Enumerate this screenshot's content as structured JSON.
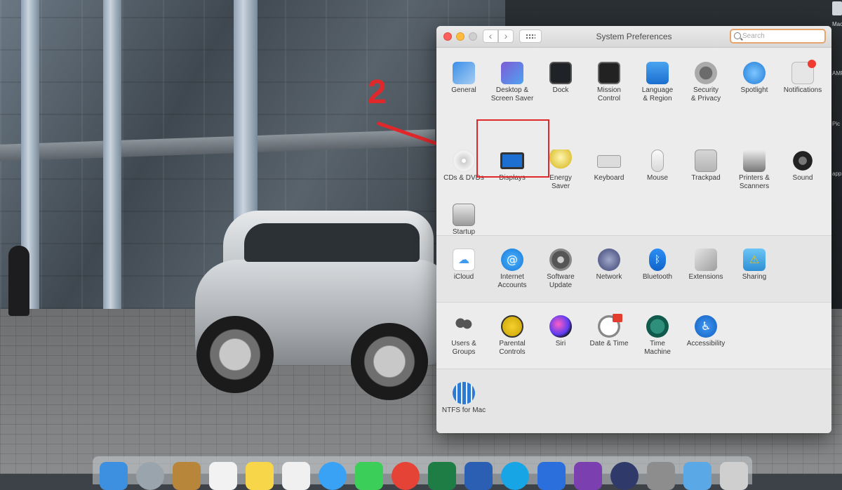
{
  "window": {
    "title": "System Preferences",
    "search_placeholder": "Search"
  },
  "sections": {
    "personal": [
      {
        "label": "General",
        "icon": "general-icon"
      },
      {
        "label": "Desktop &\nScreen Saver",
        "icon": "desktop-screensaver-icon"
      },
      {
        "label": "Dock",
        "icon": "dock-icon"
      },
      {
        "label": "Mission\nControl",
        "icon": "mission-control-icon"
      },
      {
        "label": "Language\n& Region",
        "icon": "language-region-icon"
      },
      {
        "label": "Security\n& Privacy",
        "icon": "security-privacy-icon"
      },
      {
        "label": "Spotlight",
        "icon": "spotlight-icon"
      },
      {
        "label": "Notifications",
        "icon": "notifications-icon"
      }
    ],
    "hardware": [
      {
        "label": "CDs & DVDs",
        "icon": "cds-dvds-icon"
      },
      {
        "label": "Displays",
        "icon": "displays-icon"
      },
      {
        "label": "Energy\nSaver",
        "icon": "energy-saver-icon"
      },
      {
        "label": "Keyboard",
        "icon": "keyboard-icon"
      },
      {
        "label": "Mouse",
        "icon": "mouse-icon"
      },
      {
        "label": "Trackpad",
        "icon": "trackpad-icon"
      },
      {
        "label": "Printers &\nScanners",
        "icon": "printers-scanners-icon"
      },
      {
        "label": "Sound",
        "icon": "sound-icon"
      },
      {
        "label": "Startup\nDisk",
        "icon": "startup-disk-icon"
      }
    ],
    "internet": [
      {
        "label": "iCloud",
        "icon": "icloud-icon"
      },
      {
        "label": "Internet\nAccounts",
        "icon": "internet-accounts-icon"
      },
      {
        "label": "Software\nUpdate",
        "icon": "software-update-icon"
      },
      {
        "label": "Network",
        "icon": "network-icon"
      },
      {
        "label": "Bluetooth",
        "icon": "bluetooth-icon"
      },
      {
        "label": "Extensions",
        "icon": "extensions-icon"
      },
      {
        "label": "Sharing",
        "icon": "sharing-icon"
      }
    ],
    "system": [
      {
        "label": "Users &\nGroups",
        "icon": "users-groups-icon"
      },
      {
        "label": "Parental\nControls",
        "icon": "parental-controls-icon"
      },
      {
        "label": "Siri",
        "icon": "siri-icon"
      },
      {
        "label": "Date & Time",
        "icon": "date-time-icon"
      },
      {
        "label": "Time\nMachine",
        "icon": "time-machine-icon"
      },
      {
        "label": "Accessibility",
        "icon": "accessibility-icon"
      }
    ],
    "other": [
      {
        "label": "NTFS for Mac",
        "icon": "ntfs-icon"
      }
    ]
  },
  "annotation": {
    "step": "2",
    "color": "#e0282b",
    "highlighted_item": "Displays"
  },
  "desktop": {
    "edge_labels": [
      "Macintosh HD",
      "AMP",
      "Pic",
      "app"
    ]
  },
  "colors": {
    "search_focus": "#e8a56b",
    "close": "#fc605c",
    "minimize": "#fdbc40"
  }
}
